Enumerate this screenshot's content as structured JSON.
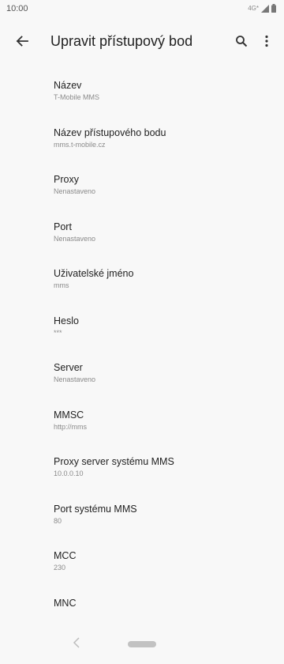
{
  "status_bar": {
    "time": "10:00",
    "network": "4G*"
  },
  "app_bar": {
    "title": "Upravit přístupový bod",
    "back_icon": "arrow-back-icon",
    "search_icon": "search-icon",
    "more_icon": "more-vert-icon"
  },
  "settings": [
    {
      "title": "Název",
      "summary": "T-Mobile MMS"
    },
    {
      "title": "Název přístupového bodu",
      "summary": "mms.t-mobile.cz"
    },
    {
      "title": "Proxy",
      "summary": "Nenastaveno"
    },
    {
      "title": "Port",
      "summary": "Nenastaveno"
    },
    {
      "title": "Uživatelské jméno",
      "summary": "mms"
    },
    {
      "title": "Heslo",
      "summary": "***"
    },
    {
      "title": "Server",
      "summary": "Nenastaveno"
    },
    {
      "title": "MMSC",
      "summary": "http://mms"
    },
    {
      "title": "Proxy server systému MMS",
      "summary": "10.0.0.10"
    },
    {
      "title": "Port systému MMS",
      "summary": "80"
    },
    {
      "title": "MCC",
      "summary": "230"
    },
    {
      "title": "MNC",
      "summary": ""
    }
  ],
  "nav_bar": {
    "back_icon": "nav-back-icon",
    "home_icon": "home-pill-icon"
  }
}
